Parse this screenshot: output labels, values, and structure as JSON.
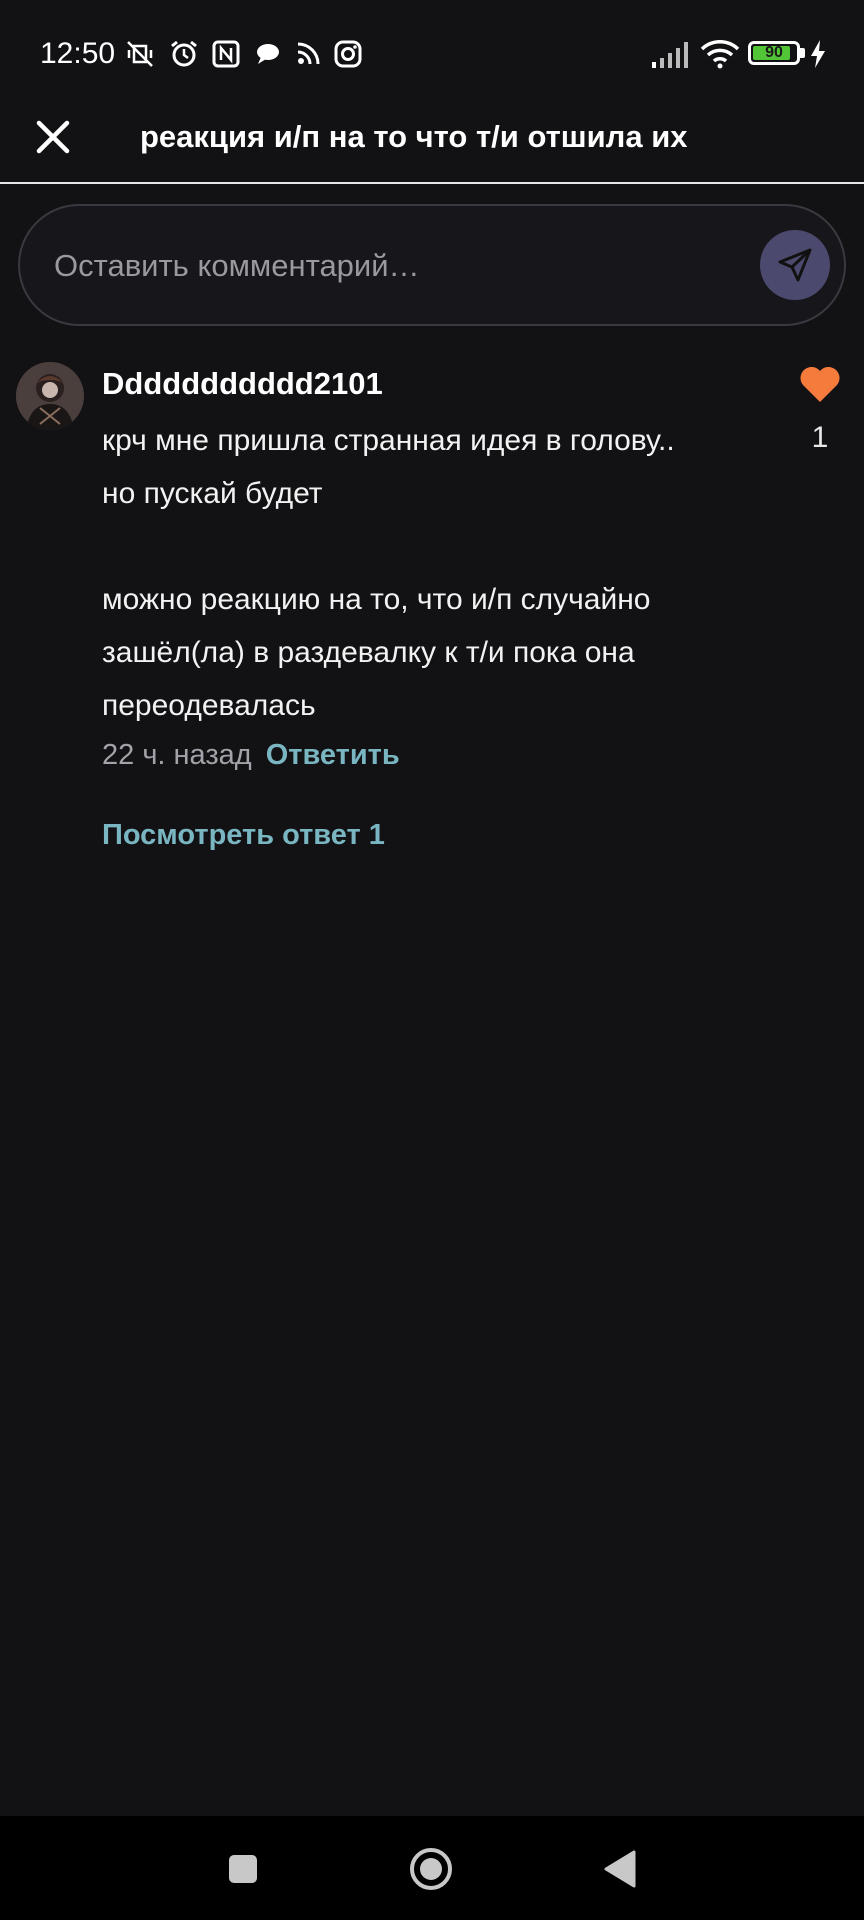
{
  "status_bar": {
    "time": "12:50",
    "battery_level": "90",
    "battery_fraction": 0.9,
    "icons": [
      "mute-vibrate-icon",
      "alarm-icon",
      "nfc-icon",
      "message-bubble-icon",
      "rss-icon",
      "instagram-icon",
      "signal-icon",
      "wifi-icon",
      "battery-icon",
      "charging-icon"
    ]
  },
  "header": {
    "title": "реакция и/п на то что т/и отшила их",
    "close_icon": "close-icon"
  },
  "comment_input": {
    "placeholder": "Оставить комментарий…",
    "value": "",
    "send_icon": "send-icon"
  },
  "comments": [
    {
      "author": "Ddddddddddd2101",
      "text": "крч мне пришла странная идея в голову..\nно пускай будет\n\nможно реакцию на то, что и/п случайно\nзашёл(ла) в раздевалку к т/и пока она\nпереодевалась",
      "time": "22 ч. назад",
      "reply_label": "Ответить",
      "likes": "1",
      "view_replies_label": "Посмотреть ответ 1"
    }
  ],
  "colors": {
    "background": "#121114",
    "accent_link": "#7ab6c2",
    "like": "#f47b3b",
    "send_button": "#4b4a6e",
    "battery": "#52c437"
  },
  "nav_bar": {
    "icons": [
      "recents-square-icon",
      "home-circle-icon",
      "back-triangle-icon"
    ]
  }
}
